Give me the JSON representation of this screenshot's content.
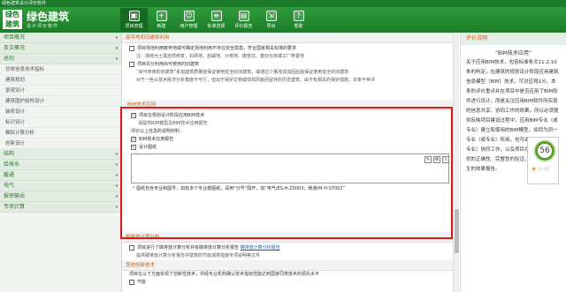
{
  "window_title": "绿色建筑设计评价软件",
  "header": {
    "logo_text": "绿色\n建筑",
    "app_title": "绿色建筑",
    "app_subtitle": "设计评价软件",
    "nav": [
      {
        "label": "项目管理",
        "icon": "folder-icon",
        "active": true
      },
      {
        "label": "新建",
        "icon": "new-icon",
        "active": false
      },
      {
        "label": "用户管理",
        "icon": "user-icon",
        "active": false
      },
      {
        "label": "标准选择",
        "icon": "standard-icon",
        "active": false
      },
      {
        "label": "评价报告",
        "icon": "report-icon",
        "active": false
      },
      {
        "label": "导出",
        "icon": "export-icon",
        "active": false
      },
      {
        "label": "帮助",
        "icon": "help-icon",
        "active": false
      }
    ]
  },
  "sidebar": [
    {
      "type": "cat",
      "label": "项目概况"
    },
    {
      "type": "cat",
      "label": "条文概况"
    },
    {
      "type": "cat",
      "label": "总则"
    },
    {
      "type": "sub",
      "label": "总体信息技术指标"
    },
    {
      "type": "sub",
      "label": "建筑规划"
    },
    {
      "type": "sub",
      "label": "景观设计"
    },
    {
      "type": "sub",
      "label": "建筑围护结构设计"
    },
    {
      "type": "sub",
      "label": "装修设计"
    },
    {
      "type": "sub",
      "label": "标识设计"
    },
    {
      "type": "sub",
      "label": "模拟计算分析"
    },
    {
      "type": "sub",
      "label": "创新设计"
    },
    {
      "type": "cat",
      "label": "结构"
    },
    {
      "type": "cat",
      "label": "给排水"
    },
    {
      "type": "cat",
      "label": "暖通"
    },
    {
      "type": "cat",
      "label": "电气"
    },
    {
      "type": "cat",
      "label": "报审输出"
    },
    {
      "type": "cat",
      "label": "专项计算"
    }
  ],
  "main": {
    "section1_title": "废弃地和旧建筑利用",
    "section1_rows": [
      "项目场地利用废弃地或可确定场地利用不存在安全隐患，符合国家相关标准的要求",
      "注：场地为土壤自然修复，石砾地、盐碱地、沙荒地、废窑坑、废旧仓库或工厂弃置地",
      "项目充分利用尚可使用的旧建筑",
      "“尚可使用的旧建筑”系指建筑质量能保证使用安全的旧建筑，或通过少量改造加固后能保证使用安全的旧建筑",
      "对于一些从技术经济分析角度不可行，但出于保护文物或体现风貌而留存的历史建筑，由于有相关的保护措施，本条不参评"
    ],
    "bim_title": "BIM技术应用",
    "bim_rows": [
      "项目在规划设计阶段应用BIM技术",
      "请提供BIM模型及BIM技术应用报告",
      "评价以上信息的说明材料：",
      "BIM技术应用报告",
      "设计图纸"
    ],
    "bim_note": "图纸包含专业和图号，如有多个专业按图纸，请用“分号”隔开，如“电气/ES-H-Z0003；暖通/M-H-ST002”",
    "section3_title": "碳排放计算分析",
    "section3_rows": [
      "项目进行了碳排放计算分析并有碳排放计算分析报告",
      "提供碳排放计算分析报告中建筑的节能减排措施专项说明等文件"
    ],
    "section3_link": "碳排放计算分析报告",
    "section4_title": "其他创新技术",
    "section4_rows": [
      "项目在以下方面实现了创新性技术，并经专业机构确认技术指标性能达到国家同类技术的领先水平",
      "节能"
    ]
  },
  "right": {
    "header": "评价说明",
    "title": "“BIM技术应用”",
    "body": "关于应用BIM技术，包括标准条文11.2.10条的判定，在建筑的规划设计阶段应用建筑信息模型（BIM）技术，可对应得1分，本条的评价重点并在项目中是否应用了BIM软件进行设计，而是关注应用BIM软件所实现的信息共享、协同工作的效果。所以必须提供反映项目建设过程中，应用BIM专业（或专业）建立和使用的BIM模型，如同为同一专业（或专业）所用，也可由不同专业（或专业）协同工作，以及项目在规划设计中提供的正确性、完整性的验证，并及应用所产生的效果报告。",
    "score": "56",
    "stars_on": 1,
    "stars_total": 3
  },
  "colors": {
    "brand": "#1c7c28",
    "highlight": "#e01a1a",
    "section": "#c0621a"
  }
}
